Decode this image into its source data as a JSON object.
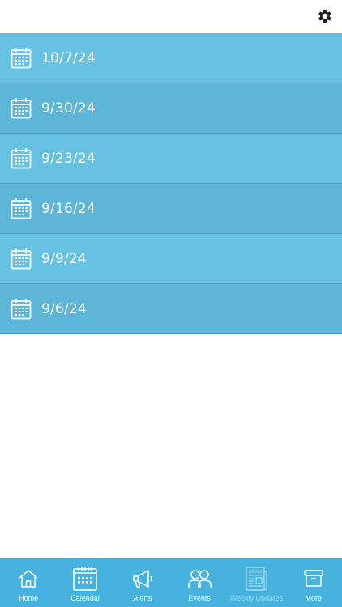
{
  "header": {
    "settings_icon": "gear-icon"
  },
  "list": {
    "items": [
      {
        "date": "10/7/24",
        "icon": "calendar-icon"
      },
      {
        "date": "9/30/24",
        "icon": "calendar-icon"
      },
      {
        "date": "9/23/24",
        "icon": "calendar-icon"
      },
      {
        "date": "9/16/24",
        "icon": "calendar-icon"
      },
      {
        "date": "9/9/24",
        "icon": "calendar-icon"
      },
      {
        "date": "9/6/24",
        "icon": "calendar-icon"
      }
    ]
  },
  "tabbar": {
    "tabs": [
      {
        "label": "Home",
        "icon": "home-icon"
      },
      {
        "label": "Calendar",
        "icon": "calendar-icon"
      },
      {
        "label": "Alerts",
        "icon": "megaphone-icon"
      },
      {
        "label": "Events",
        "icon": "people-icon"
      },
      {
        "label": "Weekly Updates",
        "icon": "newspaper-icon",
        "selected": true
      },
      {
        "label": "More",
        "icon": "archive-box-icon"
      }
    ]
  },
  "colors": {
    "row_light": "#66c1e3",
    "row_dark": "#5db5d8",
    "tabbar": "#46b2dd",
    "tab_selected": "#a4dbf0"
  }
}
